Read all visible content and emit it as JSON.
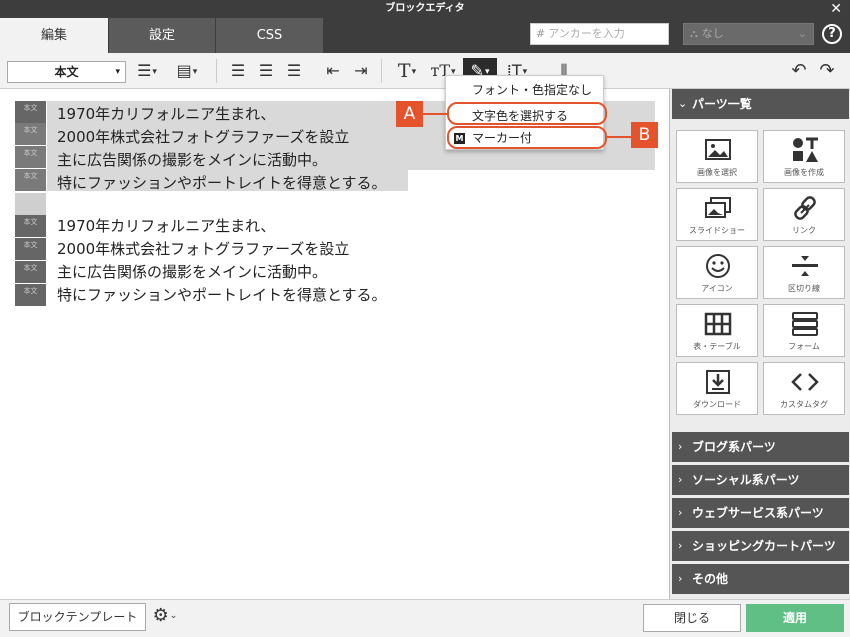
{
  "window": {
    "title": "ブロックエディタ",
    "close": "✕"
  },
  "tabs": [
    {
      "label": "編集",
      "active": true
    },
    {
      "label": "設定",
      "active": false
    },
    {
      "label": "CSS",
      "active": false
    }
  ],
  "anchor": {
    "prefix": "#",
    "placeholder": "アンカーを入力",
    "select_value": "なし"
  },
  "help": "?",
  "toolbar": {
    "style_select": "本文"
  },
  "blocks": {
    "tag": "本文",
    "group1": [
      "1970年カリフォルニア生まれ、",
      "2000年株式会社フォトグラファーズを設立",
      "主に広告関係の撮影をメインに活動中。",
      "特にファッションやポートレイトを得意とする。"
    ],
    "group2": [
      "1970年カリフォルニア生まれ、",
      "2000年株式会社フォトグラファーズを設立",
      "主に広告関係の撮影をメインに活動中。",
      "特にファッションやポートレイトを得意とする。"
    ]
  },
  "dropdown": {
    "items": [
      {
        "label": "フォント・色指定なし"
      },
      {
        "label": "文字色を選択する"
      },
      {
        "label": "マーカー付",
        "icon": "M"
      }
    ]
  },
  "callouts": {
    "a": "A",
    "b": "B",
    "color": "#e5532d"
  },
  "sidebar": {
    "parts_title": "パーツ一覧",
    "parts": [
      {
        "label": "画像を選択",
        "icon": "image-icon"
      },
      {
        "label": "画像を作成",
        "icon": "shapes-icon"
      },
      {
        "label": "スライドショー",
        "icon": "slideshow-icon"
      },
      {
        "label": "リンク",
        "icon": "link-icon"
      },
      {
        "label": "アイコン",
        "icon": "smiley-icon"
      },
      {
        "label": "区切り線",
        "icon": "divider-icon"
      },
      {
        "label": "表・テーブル",
        "icon": "table-icon"
      },
      {
        "label": "フォーム",
        "icon": "form-icon"
      },
      {
        "label": "ダウンロード",
        "icon": "download-icon"
      },
      {
        "label": "カスタムタグ",
        "icon": "code-icon"
      }
    ],
    "categories": [
      {
        "label": "ブログ系パーツ"
      },
      {
        "label": "ソーシャル系パーツ"
      },
      {
        "label": "ウェブサービス系パーツ"
      },
      {
        "label": "ショッピングカートパーツ"
      },
      {
        "label": "その他"
      }
    ]
  },
  "footer": {
    "template_button": "ブロックテンプレート",
    "close_button": "閉じる",
    "apply_button": "適用"
  },
  "colors": {
    "accent": "#e5532d",
    "apply": "#5fbf85",
    "dark_chrome": "#3d3d3d"
  }
}
